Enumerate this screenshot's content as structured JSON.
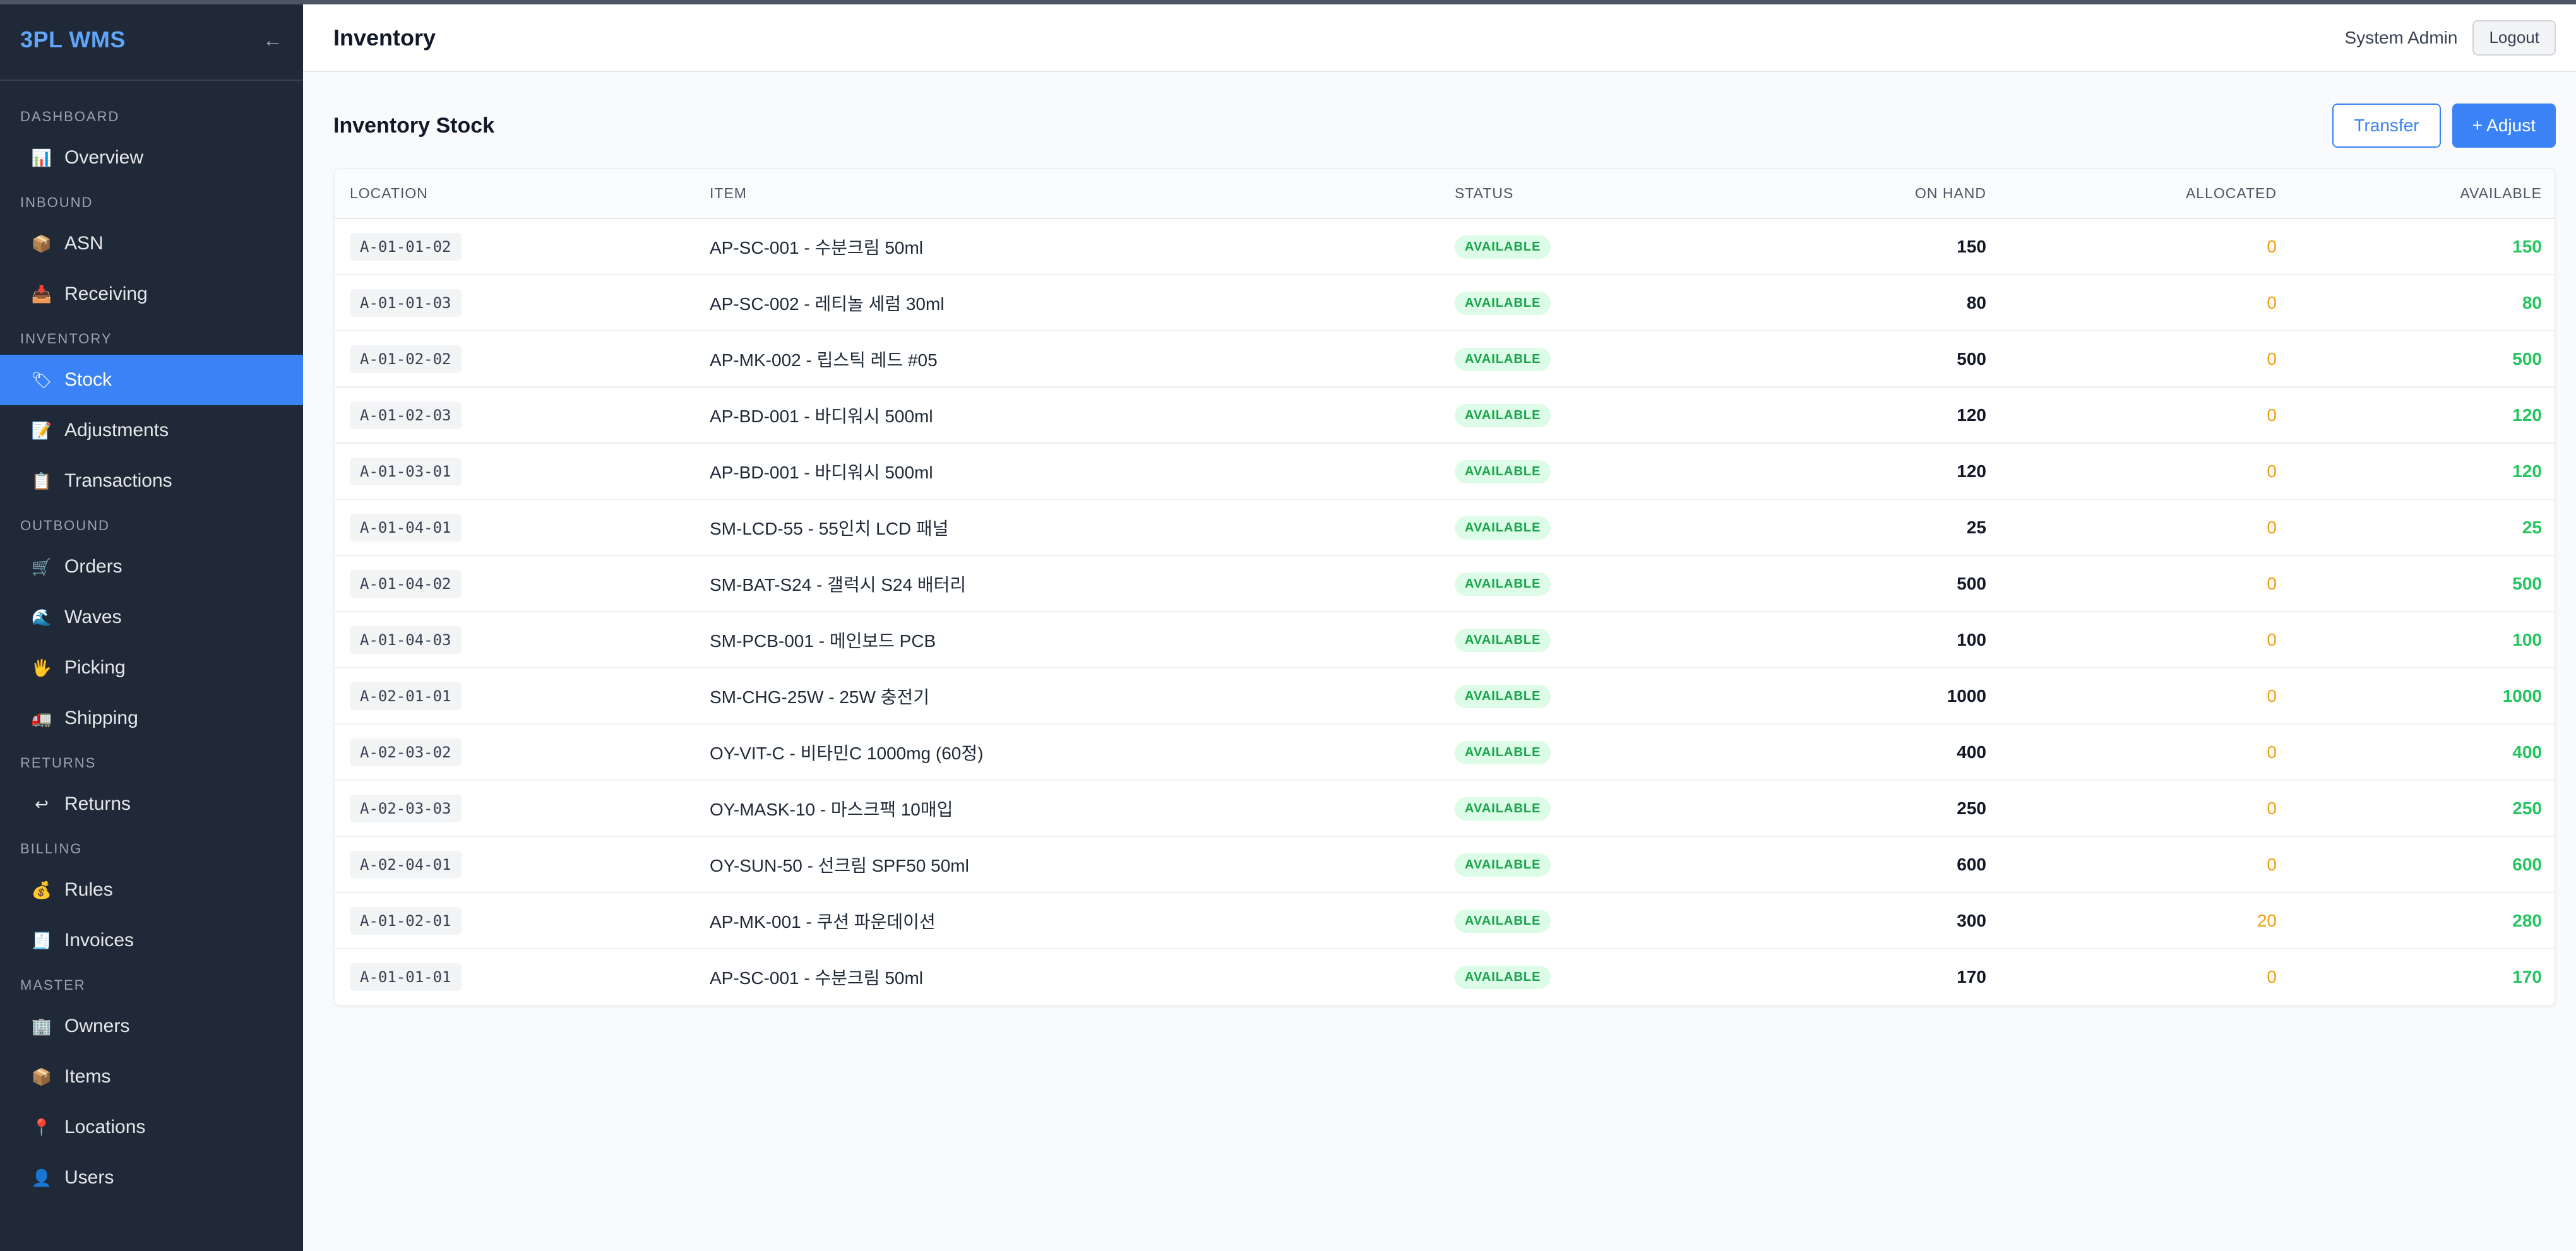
{
  "app": {
    "title": "3PL WMS"
  },
  "sidebar": {
    "sections": [
      {
        "label": "DASHBOARD",
        "items": [
          {
            "label": "Overview",
            "icon": "📊",
            "icon_name": "chart-icon"
          }
        ]
      },
      {
        "label": "INBOUND",
        "items": [
          {
            "label": "ASN",
            "icon": "📦",
            "icon_name": "package-icon"
          },
          {
            "label": "Receiving",
            "icon": "📥",
            "icon_name": "inbox-tray-icon"
          }
        ]
      },
      {
        "label": "INVENTORY",
        "items": [
          {
            "label": "Stock",
            "icon": "🏷",
            "icon_name": "label-icon",
            "active": true
          },
          {
            "label": "Adjustments",
            "icon": "📝",
            "icon_name": "memo-icon"
          },
          {
            "label": "Transactions",
            "icon": "📋",
            "icon_name": "clipboard-icon"
          }
        ]
      },
      {
        "label": "OUTBOUND",
        "items": [
          {
            "label": "Orders",
            "icon": "🛒",
            "icon_name": "cart-icon"
          },
          {
            "label": "Waves",
            "icon": "🌊",
            "icon_name": "wave-icon"
          },
          {
            "label": "Picking",
            "icon": "🖐",
            "icon_name": "hand-icon"
          },
          {
            "label": "Shipping",
            "icon": "🚛",
            "icon_name": "truck-icon"
          }
        ]
      },
      {
        "label": "RETURNS",
        "items": [
          {
            "label": "Returns",
            "icon": "↩",
            "icon_name": "return-icon"
          }
        ]
      },
      {
        "label": "BILLING",
        "items": [
          {
            "label": "Rules",
            "icon": "💰",
            "icon_name": "money-bag-icon"
          },
          {
            "label": "Invoices",
            "icon": "🧾",
            "icon_name": "receipt-icon"
          }
        ]
      },
      {
        "label": "MASTER",
        "items": [
          {
            "label": "Owners",
            "icon": "🏢",
            "icon_name": "building-icon"
          },
          {
            "label": "Items",
            "icon": "📦",
            "icon_name": "package-icon"
          },
          {
            "label": "Locations",
            "icon": "📍",
            "icon_name": "pin-icon"
          },
          {
            "label": "Users",
            "icon": "👤",
            "icon_name": "user-icon"
          }
        ]
      }
    ]
  },
  "header": {
    "title": "Inventory",
    "user": "System Admin",
    "logout_label": "Logout"
  },
  "main": {
    "section_title": "Inventory Stock",
    "transfer_label": "Transfer",
    "adjust_label": "+ Adjust",
    "columns": {
      "location": "LOCATION",
      "item": "ITEM",
      "status": "STATUS",
      "on_hand": "ON HAND",
      "allocated": "ALLOCATED",
      "available": "AVAILABLE"
    },
    "rows": [
      {
        "location": "A-01-01-02",
        "item": "AP-SC-001 - 수분크림 50ml",
        "status": "AVAILABLE",
        "on_hand": "150",
        "allocated": "0",
        "available": "150"
      },
      {
        "location": "A-01-01-03",
        "item": "AP-SC-002 - 레티놀 세럼 30ml",
        "status": "AVAILABLE",
        "on_hand": "80",
        "allocated": "0",
        "available": "80"
      },
      {
        "location": "A-01-02-02",
        "item": "AP-MK-002 - 립스틱 레드 #05",
        "status": "AVAILABLE",
        "on_hand": "500",
        "allocated": "0",
        "available": "500"
      },
      {
        "location": "A-01-02-03",
        "item": "AP-BD-001 - 바디워시 500ml",
        "status": "AVAILABLE",
        "on_hand": "120",
        "allocated": "0",
        "available": "120"
      },
      {
        "location": "A-01-03-01",
        "item": "AP-BD-001 - 바디워시 500ml",
        "status": "AVAILABLE",
        "on_hand": "120",
        "allocated": "0",
        "available": "120"
      },
      {
        "location": "A-01-04-01",
        "item": "SM-LCD-55 - 55인치 LCD 패널",
        "status": "AVAILABLE",
        "on_hand": "25",
        "allocated": "0",
        "available": "25"
      },
      {
        "location": "A-01-04-02",
        "item": "SM-BAT-S24 - 갤럭시 S24 배터리",
        "status": "AVAILABLE",
        "on_hand": "500",
        "allocated": "0",
        "available": "500"
      },
      {
        "location": "A-01-04-03",
        "item": "SM-PCB-001 - 메인보드 PCB",
        "status": "AVAILABLE",
        "on_hand": "100",
        "allocated": "0",
        "available": "100"
      },
      {
        "location": "A-02-01-01",
        "item": "SM-CHG-25W - 25W 충전기",
        "status": "AVAILABLE",
        "on_hand": "1000",
        "allocated": "0",
        "available": "1000"
      },
      {
        "location": "A-02-03-02",
        "item": "OY-VIT-C - 비타민C 1000mg (60정)",
        "status": "AVAILABLE",
        "on_hand": "400",
        "allocated": "0",
        "available": "400"
      },
      {
        "location": "A-02-03-03",
        "item": "OY-MASK-10 - 마스크팩 10매입",
        "status": "AVAILABLE",
        "on_hand": "250",
        "allocated": "0",
        "available": "250"
      },
      {
        "location": "A-02-04-01",
        "item": "OY-SUN-50 - 선크림 SPF50 50ml",
        "status": "AVAILABLE",
        "on_hand": "600",
        "allocated": "0",
        "available": "600"
      },
      {
        "location": "A-01-02-01",
        "item": "AP-MK-001 - 쿠션 파운데이션",
        "status": "AVAILABLE",
        "on_hand": "300",
        "allocated": "20",
        "available": "280"
      },
      {
        "location": "A-01-01-01",
        "item": "AP-SC-001 - 수분크림 50ml",
        "status": "AVAILABLE",
        "on_hand": "170",
        "allocated": "0",
        "available": "170"
      }
    ]
  },
  "colors": {
    "sidebar_bg": "#1f2937",
    "accent": "#3b82f6",
    "brand": "#60a5fa",
    "allocated": "#f59e0b",
    "available": "#22c55e"
  }
}
